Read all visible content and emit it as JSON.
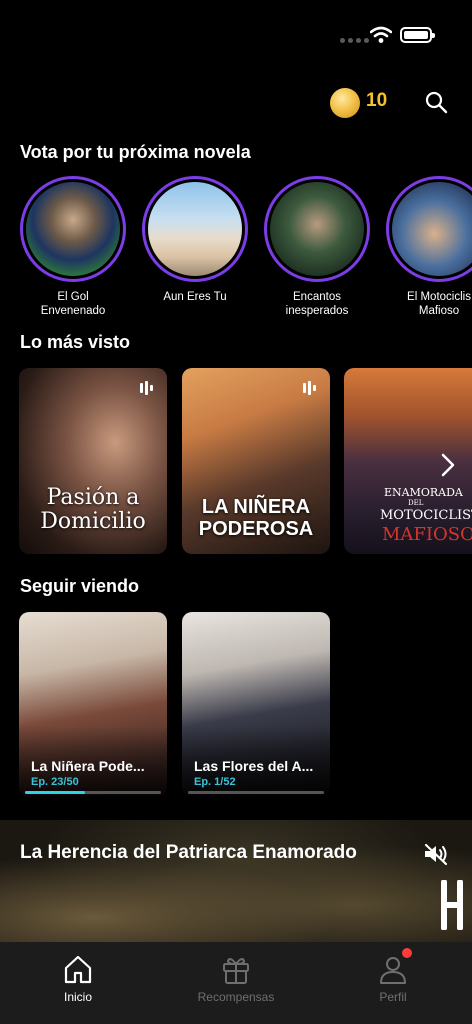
{
  "top_bar": {
    "coin_count": "10"
  },
  "sections": {
    "vote_title": "Vota por tu próxima novela",
    "most_viewed_title": "Lo más visto",
    "continue_title": "Seguir viendo"
  },
  "vote_items": [
    {
      "label": "El Gol\nEnvenenado"
    },
    {
      "label": "Aun Eres Tu"
    },
    {
      "label": "Encantos\ninesperados"
    },
    {
      "label": "El Motociclis\nMafioso"
    }
  ],
  "most_viewed": [
    {
      "title": "Pasión a\nDomicilio"
    },
    {
      "title": "LA NIÑERA\nPODEROSA"
    },
    {
      "title_small": "ENAMORADA",
      "title_tiny": "DEL",
      "title_mid": "MOTOCICLISTA",
      "title_big": "MAFIOSO"
    }
  ],
  "continue_watching": [
    {
      "title": "La Niñera Pode...",
      "episode": "Ep. 23/50",
      "progress": 0.44
    },
    {
      "title": "Las Flores del A...",
      "episode": "Ep. 1/52",
      "progress": 0.0
    }
  ],
  "featured": {
    "title": "La Herencia del Patriarca Enamorado"
  },
  "nav": {
    "home": "Inicio",
    "rewards": "Recompensas",
    "profile": "Perfil"
  },
  "colors": {
    "accent_gold": "#f6c32d",
    "ring_purple": "#7c3de6",
    "progress_cyan": "#2fd2e8",
    "notification_red": "#ff3b3b"
  }
}
